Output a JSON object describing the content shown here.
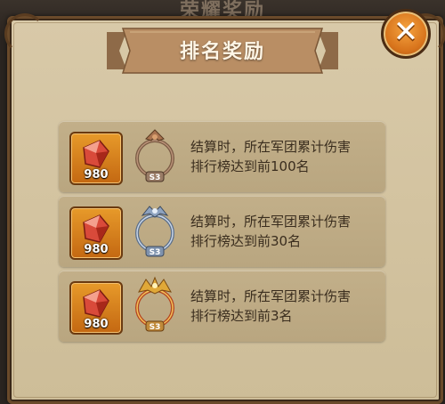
{
  "background_title": "荣耀奖励",
  "dialog": {
    "title": "排名奖励",
    "close_symbol": "✕"
  },
  "rewards": [
    {
      "item_icon": "red-gem-icon",
      "item_count": "980",
      "frame_icon": "bronze-avatar-frame-icon",
      "frame_badge": "S3",
      "line1": "结算时，所在军团累计伤害",
      "line2": "排行榜达到前100名"
    },
    {
      "item_icon": "red-gem-icon",
      "item_count": "980",
      "frame_icon": "silver-avatar-frame-icon",
      "frame_badge": "S3",
      "line1": "结算时，所在军团累计伤害",
      "line2": "排行榜达到前30名"
    },
    {
      "item_icon": "red-gem-icon",
      "item_count": "980",
      "frame_icon": "gold-avatar-frame-icon",
      "frame_badge": "S3",
      "line1": "结算时，所在军团累计伤害",
      "line2": "排行榜达到前3名"
    }
  ],
  "colors": {
    "panel": "#d6c7a4",
    "card": "#bfac86",
    "ribbon": "#b98e64",
    "close_button": "#e07f22",
    "text": "#3a2d1e"
  }
}
